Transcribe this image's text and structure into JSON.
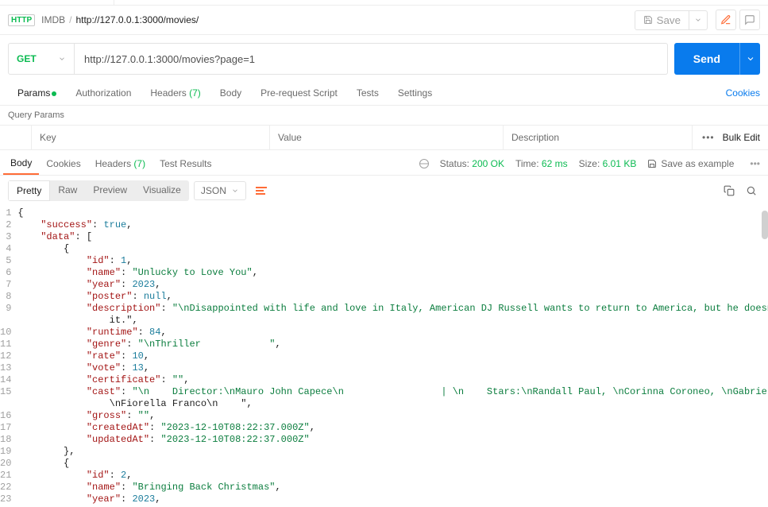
{
  "breadcrumb": {
    "collection": "IMDB",
    "path": "http://127.0.0.1:3000/movies/"
  },
  "toolbar": {
    "save": "Save"
  },
  "request": {
    "method": "GET",
    "url": "http://127.0.0.1:3000/movies?page=1",
    "send": "Send"
  },
  "tabs": {
    "params": "Params",
    "authorization": "Authorization",
    "headers": "Headers",
    "headers_count": "(7)",
    "body": "Body",
    "prerequest": "Pre-request Script",
    "tests": "Tests",
    "settings": "Settings",
    "cookies": "Cookies"
  },
  "query_params": {
    "title": "Query Params",
    "key": "Key",
    "value": "Value",
    "description": "Description",
    "bulk_edit": "Bulk Edit"
  },
  "response_tabs": {
    "body": "Body",
    "cookies": "Cookies",
    "headers": "Headers",
    "headers_count": "(7)",
    "test_results": "Test Results"
  },
  "response_meta": {
    "status_label": "Status:",
    "status_value": "200 OK",
    "time_label": "Time:",
    "time_value": "62 ms",
    "size_label": "Size:",
    "size_value": "6.01 KB",
    "save_example": "Save as example"
  },
  "view": {
    "pretty": "Pretty",
    "raw": "Raw",
    "preview": "Preview",
    "visualize": "Visualize",
    "lang": "JSON"
  },
  "code_lines": [
    [
      {
        "t": "p",
        "v": "{"
      }
    ],
    [
      {
        "t": "p",
        "v": "    "
      },
      {
        "t": "k",
        "v": "\"success\""
      },
      {
        "t": "p",
        "v": ": "
      },
      {
        "t": "n",
        "v": "true"
      },
      {
        "t": "p",
        "v": ","
      }
    ],
    [
      {
        "t": "p",
        "v": "    "
      },
      {
        "t": "k",
        "v": "\"data\""
      },
      {
        "t": "p",
        "v": ": ["
      }
    ],
    [
      {
        "t": "p",
        "v": "        {"
      }
    ],
    [
      {
        "t": "p",
        "v": "            "
      },
      {
        "t": "k",
        "v": "\"id\""
      },
      {
        "t": "p",
        "v": ": "
      },
      {
        "t": "n",
        "v": "1"
      },
      {
        "t": "p",
        "v": ","
      }
    ],
    [
      {
        "t": "p",
        "v": "            "
      },
      {
        "t": "k",
        "v": "\"name\""
      },
      {
        "t": "p",
        "v": ": "
      },
      {
        "t": "s",
        "v": "\"Unlucky to Love You\""
      },
      {
        "t": "p",
        "v": ","
      }
    ],
    [
      {
        "t": "p",
        "v": "            "
      },
      {
        "t": "k",
        "v": "\"year\""
      },
      {
        "t": "p",
        "v": ": "
      },
      {
        "t": "n",
        "v": "2023"
      },
      {
        "t": "p",
        "v": ","
      }
    ],
    [
      {
        "t": "p",
        "v": "            "
      },
      {
        "t": "k",
        "v": "\"poster\""
      },
      {
        "t": "p",
        "v": ": "
      },
      {
        "t": "n",
        "v": "null"
      },
      {
        "t": "p",
        "v": ","
      }
    ],
    [
      {
        "t": "p",
        "v": "            "
      },
      {
        "t": "k",
        "v": "\"description\""
      },
      {
        "t": "p",
        "v": ": "
      },
      {
        "t": "s",
        "v": "\"\\nDisappointed with life and love in Italy, American DJ Russell wants to return to America, but he doesn't have the money to do \n                it.\""
      },
      {
        "t": "p",
        "v": ","
      }
    ],
    [
      {
        "t": "p",
        "v": "            "
      },
      {
        "t": "k",
        "v": "\"runtime\""
      },
      {
        "t": "p",
        "v": ": "
      },
      {
        "t": "n",
        "v": "84"
      },
      {
        "t": "p",
        "v": ","
      }
    ],
    [
      {
        "t": "p",
        "v": "            "
      },
      {
        "t": "k",
        "v": "\"genre\""
      },
      {
        "t": "p",
        "v": ": "
      },
      {
        "t": "s",
        "v": "\"\\nThriller            \""
      },
      {
        "t": "p",
        "v": ","
      }
    ],
    [
      {
        "t": "p",
        "v": "            "
      },
      {
        "t": "k",
        "v": "\"rate\""
      },
      {
        "t": "p",
        "v": ": "
      },
      {
        "t": "n",
        "v": "10"
      },
      {
        "t": "p",
        "v": ","
      }
    ],
    [
      {
        "t": "p",
        "v": "            "
      },
      {
        "t": "k",
        "v": "\"vote\""
      },
      {
        "t": "p",
        "v": ": "
      },
      {
        "t": "n",
        "v": "13"
      },
      {
        "t": "p",
        "v": ","
      }
    ],
    [
      {
        "t": "p",
        "v": "            "
      },
      {
        "t": "k",
        "v": "\"certificate\""
      },
      {
        "t": "p",
        "v": ": "
      },
      {
        "t": "s",
        "v": "\"\""
      },
      {
        "t": "p",
        "v": ","
      }
    ],
    [
      {
        "t": "p",
        "v": "            "
      },
      {
        "t": "k",
        "v": "\"cast\""
      },
      {
        "t": "p",
        "v": ": "
      },
      {
        "t": "s",
        "v": "\"\\n    Director:\\nMauro John Capece\\n                 | \\n    Stars:\\nRandall Paul, \\nCorinna Coroneo, \\nGabriele Silvestrini, \n                \\nFiorella Franco\\n    \""
      },
      {
        "t": "p",
        "v": ","
      }
    ],
    [
      {
        "t": "p",
        "v": "            "
      },
      {
        "t": "k",
        "v": "\"gross\""
      },
      {
        "t": "p",
        "v": ": "
      },
      {
        "t": "s",
        "v": "\"\""
      },
      {
        "t": "p",
        "v": ","
      }
    ],
    [
      {
        "t": "p",
        "v": "            "
      },
      {
        "t": "k",
        "v": "\"createdAt\""
      },
      {
        "t": "p",
        "v": ": "
      },
      {
        "t": "s",
        "v": "\"2023-12-10T08:22:37.000Z\""
      },
      {
        "t": "p",
        "v": ","
      }
    ],
    [
      {
        "t": "p",
        "v": "            "
      },
      {
        "t": "k",
        "v": "\"updatedAt\""
      },
      {
        "t": "p",
        "v": ": "
      },
      {
        "t": "s",
        "v": "\"2023-12-10T08:22:37.000Z\""
      }
    ],
    [
      {
        "t": "p",
        "v": "        },"
      }
    ],
    [
      {
        "t": "p",
        "v": "        {"
      }
    ],
    [
      {
        "t": "p",
        "v": "            "
      },
      {
        "t": "k",
        "v": "\"id\""
      },
      {
        "t": "p",
        "v": ": "
      },
      {
        "t": "n",
        "v": "2"
      },
      {
        "t": "p",
        "v": ","
      }
    ],
    [
      {
        "t": "p",
        "v": "            "
      },
      {
        "t": "k",
        "v": "\"name\""
      },
      {
        "t": "p",
        "v": ": "
      },
      {
        "t": "s",
        "v": "\"Bringing Back Christmas\""
      },
      {
        "t": "p",
        "v": ","
      }
    ],
    [
      {
        "t": "p",
        "v": "            "
      },
      {
        "t": "k",
        "v": "\"year\""
      },
      {
        "t": "p",
        "v": ": "
      },
      {
        "t": "n",
        "v": "2023"
      },
      {
        "t": "p",
        "v": ","
      }
    ]
  ]
}
